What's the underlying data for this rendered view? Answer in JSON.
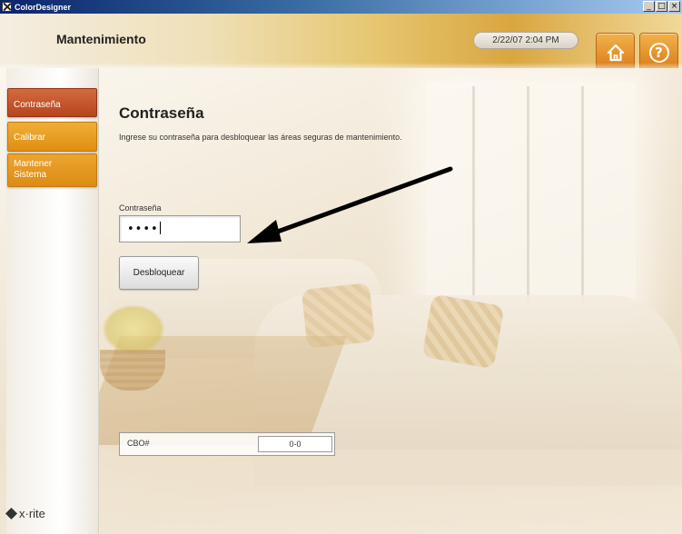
{
  "window": {
    "title": "ColorDesigner",
    "buttons": [
      "_",
      "□",
      "×"
    ]
  },
  "header": {
    "title": "Mantenimiento",
    "datetime": "2/22/07 2:04 PM",
    "home_icon": "home-icon",
    "help_icon": "help-icon",
    "help_glyph": "?"
  },
  "sidebar": {
    "items": [
      {
        "label": "Contraseña",
        "active": true
      },
      {
        "label": "Calibrar",
        "active": false
      },
      {
        "label": "Mantener Sistema",
        "active": false
      }
    ],
    "brand": "x·rite"
  },
  "main": {
    "heading": "Contraseña",
    "description": "Ingrese su contraseña para desbloquear las áreas seguras de mantenimiento.",
    "password_label": "Contraseña",
    "password_value": "••••",
    "unlock_label": "Desbloquear",
    "cbo_label": "CBO#",
    "cbo_value": "0-0"
  },
  "colors": {
    "nav_active": "#c0522a",
    "nav_inactive": "#e89a20",
    "header_button": "#e48a22"
  }
}
